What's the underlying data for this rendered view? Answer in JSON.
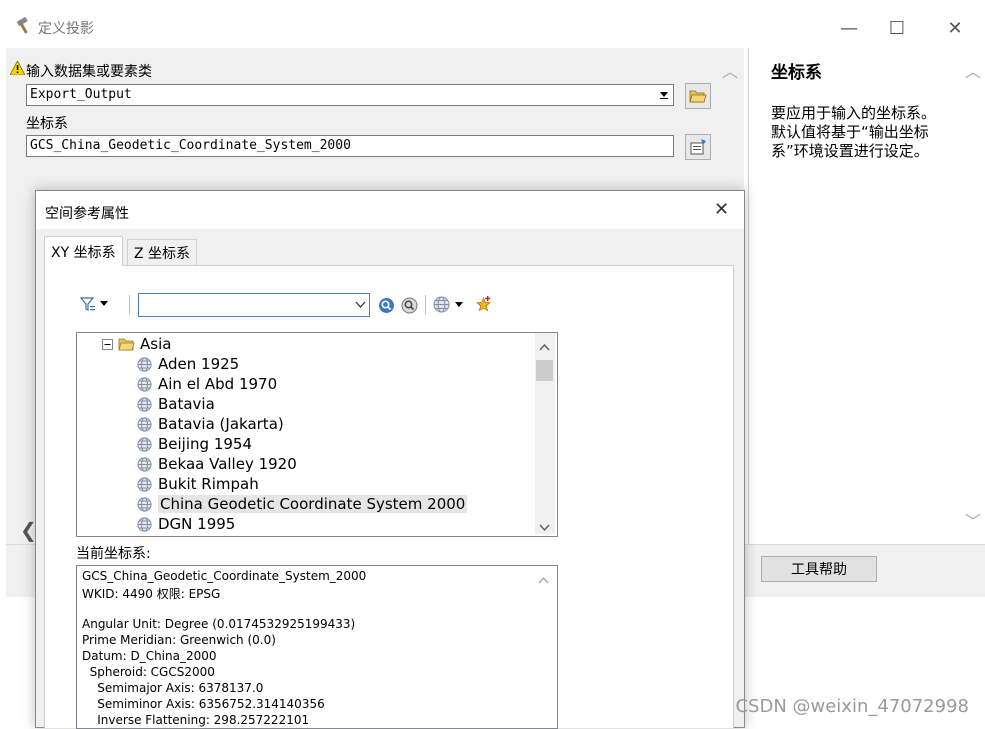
{
  "window": {
    "title": "定义投影",
    "minimize_label": "—",
    "maximize_label": "☐",
    "close_label": "✕"
  },
  "tool": {
    "input_label": "输入数据集或要素类",
    "input_value": "Export_Output",
    "coord_label": "坐标系",
    "coord_value": "GCS_China_Geodetic_Coordinate_System_2000"
  },
  "help": {
    "title": "坐标系",
    "text": "要应用于输入的坐标系。默认值将基于“输出坐标系”环境设置进行设定。",
    "button_label": "工具帮助"
  },
  "dialog": {
    "title": "空间参考属性",
    "close_label": "✕",
    "tabs": [
      {
        "label": "XY 坐标系",
        "active": true
      },
      {
        "label": "Z 坐标系",
        "active": false
      }
    ],
    "search_value": "",
    "tree": {
      "folder": "Asia",
      "items": [
        "Aden 1925",
        "Ain el Abd 1970",
        "Batavia",
        "Batavia (Jakarta)",
        "Beijing 1954",
        "Bekaa Valley 1920",
        "Bukit Rimpah",
        "China Geodetic Coordinate System 2000",
        "DGN 1995"
      ],
      "selected": "China Geodetic Coordinate System 2000"
    },
    "current_label": "当前坐标系:",
    "current_lines": [
      "GCS_China_Geodetic_Coordinate_System_2000",
      "WKID: 4490 权限: EPSG",
      "",
      "Angular Unit: Degree (0.0174532925199433)",
      "Prime Meridian: Greenwich (0.0)",
      "Datum: D_China_2000",
      "  Spheroid: CGCS2000",
      "    Semimajor Axis: 6378137.0",
      "    Semiminor Axis: 6356752.314140356",
      "    Inverse Flattening: 298.257222101"
    ]
  },
  "watermark": "CSDN @weixin_47072998",
  "colors": {
    "selection": "#e5e5e5",
    "folder": "#e8c15a",
    "globe": "#7f8fa6",
    "search_icon": "#3b78c4",
    "star": "#f2b418",
    "warning": "#f6d300"
  }
}
